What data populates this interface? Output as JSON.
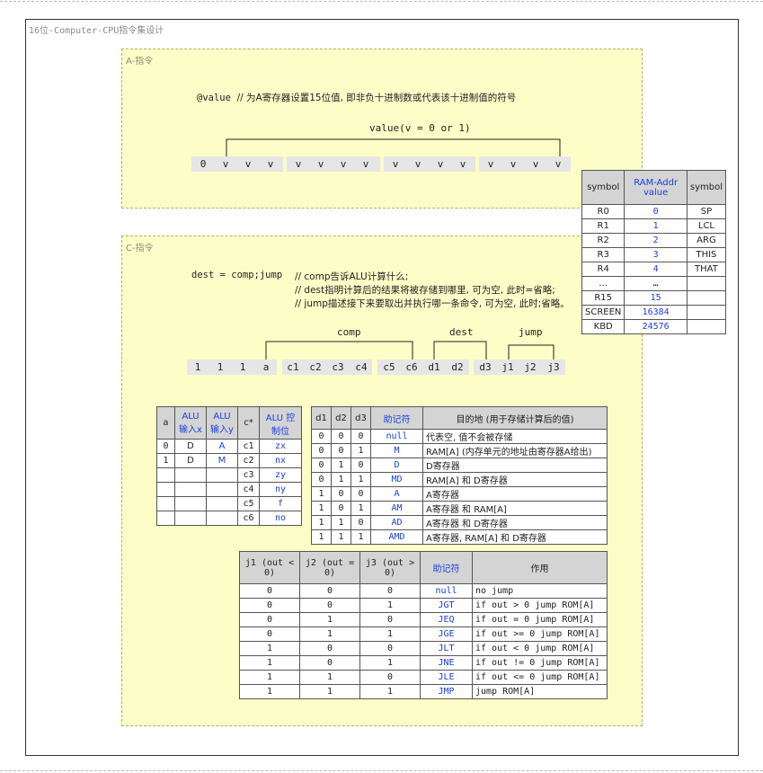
{
  "frame_title": "16位-Computer-CPU指令集设计",
  "a_instruction": {
    "title": "A-指令",
    "syntax": "@value",
    "comment": "// 为A寄存器设置15位值, 即非负十进制数或代表该十进制值的符号",
    "value_label": "value(v = 0 or 1)",
    "bits": [
      "0",
      "v",
      "v",
      "v",
      "v",
      "v",
      "v",
      "v",
      "v",
      "v",
      "v",
      "v",
      "v",
      "v",
      "v",
      "v"
    ]
  },
  "c_instruction": {
    "title": "C-指令",
    "syntax": "dest = comp;jump",
    "comments": [
      "// comp告诉ALU计算什么;",
      "// dest指明计算后的结果将被存储到哪里, 可为空, 此时=省略;",
      "// jump描述接下来要取出并执行哪一条命令, 可为空, 此时;省略。"
    ],
    "comp_label": "comp",
    "dest_label": "dest",
    "jump_label": "jump",
    "bits": [
      "1",
      "1",
      "1",
      "a",
      "c1",
      "c2",
      "c3",
      "c4",
      "c5",
      "c6",
      "d1",
      "d2",
      "d3",
      "j1",
      "j2",
      "j3"
    ]
  },
  "symbol_table": {
    "headers": [
      "symbol",
      "RAM-Addr value",
      "symbol"
    ],
    "rows": [
      [
        "R0",
        "0",
        "SP"
      ],
      [
        "R1",
        "1",
        "LCL"
      ],
      [
        "R2",
        "2",
        "ARG"
      ],
      [
        "R3",
        "3",
        "THIS"
      ],
      [
        "R4",
        "4",
        "THAT"
      ],
      [
        "…",
        "…",
        ""
      ],
      [
        "R15",
        "15",
        ""
      ],
      [
        "SCREEN",
        "16384",
        ""
      ],
      [
        "KBD",
        "24576",
        ""
      ]
    ]
  },
  "alu_table": {
    "headers": [
      "a",
      "ALU 输入x",
      "ALU 输入y",
      "c*",
      "ALU 控制位"
    ],
    "rows": [
      [
        "0",
        "D",
        "A",
        "c1",
        "zx"
      ],
      [
        "1",
        "D",
        "M",
        "c2",
        "nx"
      ],
      [
        "",
        "",
        "",
        "c3",
        "zy"
      ],
      [
        "",
        "",
        "",
        "c4",
        "ny"
      ],
      [
        "",
        "",
        "",
        "c5",
        "f"
      ],
      [
        "",
        "",
        "",
        "c6",
        "no"
      ]
    ]
  },
  "dest_table": {
    "headers": [
      "d1",
      "d2",
      "d3",
      "助记符",
      "目的地 (用于存储计算后的值)"
    ],
    "rows": [
      [
        "0",
        "0",
        "0",
        "null",
        "代表空, 值不会被存储"
      ],
      [
        "0",
        "0",
        "1",
        "M",
        "RAM[A] (内存单元的地址由寄存器A给出)"
      ],
      [
        "0",
        "1",
        "0",
        "D",
        "D寄存器"
      ],
      [
        "0",
        "1",
        "1",
        "MD",
        "RAM[A] 和 D寄存器"
      ],
      [
        "1",
        "0",
        "0",
        "A",
        "A寄存器"
      ],
      [
        "1",
        "0",
        "1",
        "AM",
        "A寄存器 和 RAM[A]"
      ],
      [
        "1",
        "1",
        "0",
        "AD",
        "A寄存器 和 D寄存器"
      ],
      [
        "1",
        "1",
        "1",
        "AMD",
        "A寄存器, RAM[A] 和 D寄存器"
      ]
    ]
  },
  "jump_table": {
    "headers": [
      "j1 (out < 0)",
      "j2 (out = 0)",
      "j3 (out > 0)",
      "助记符",
      "作用"
    ],
    "rows": [
      [
        "0",
        "0",
        "0",
        "null",
        "no jump"
      ],
      [
        "0",
        "0",
        "1",
        "JGT",
        "if out > 0 jump ROM[A]"
      ],
      [
        "0",
        "1",
        "0",
        "JEQ",
        "if out = 0 jump ROM[A]"
      ],
      [
        "0",
        "1",
        "1",
        "JGE",
        "if out >= 0 jump ROM[A]"
      ],
      [
        "1",
        "0",
        "0",
        "JLT",
        "if out < 0 jump ROM[A]"
      ],
      [
        "1",
        "0",
        "1",
        "JNE",
        "if out != 0 jump ROM[A]"
      ],
      [
        "1",
        "1",
        "0",
        "JLE",
        "if out <= 0 jump ROM[A]"
      ],
      [
        "1",
        "1",
        "1",
        "JMP",
        "jump ROM[A]"
      ]
    ]
  },
  "colors": {
    "zone_fill": "#fdfdc8",
    "header_gray": "#d4d4d4",
    "accent_blue": "#1a3fe0",
    "bit_gray": "#e6e6e6"
  }
}
